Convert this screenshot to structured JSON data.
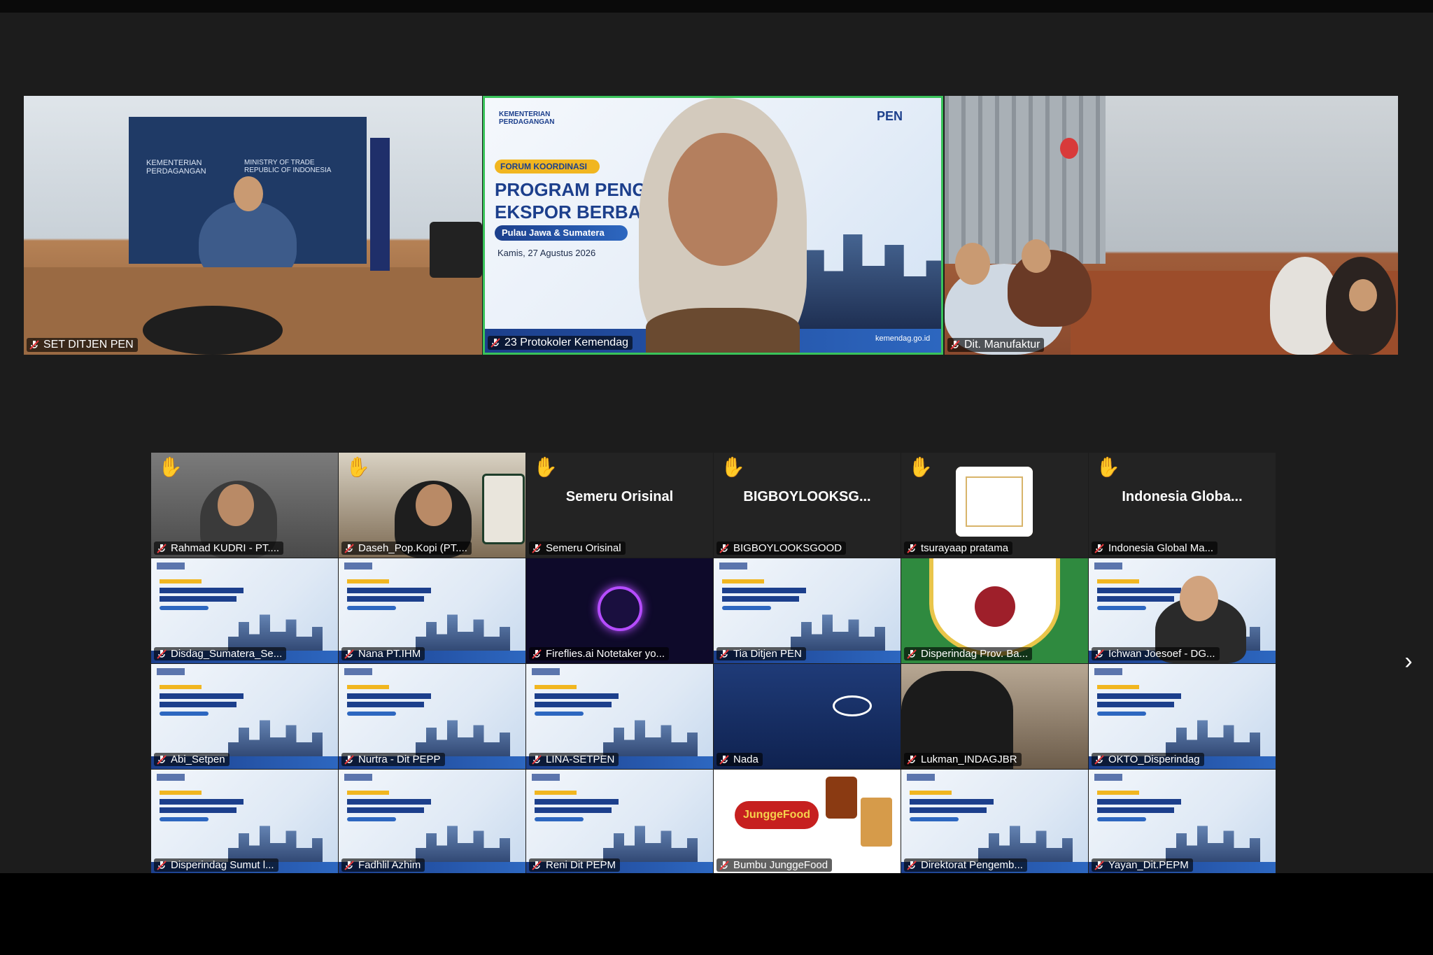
{
  "speakers": [
    {
      "name": "SET DITJEN PEN"
    },
    {
      "name": "23 Protokoler Kemendag"
    },
    {
      "name": "Dit. Manufaktur"
    }
  ],
  "slide": {
    "forum": "FORUM KOORDINASI",
    "title1": "PROGRAM PENGEMB",
    "title2": "EKSPOR BERBASIS K",
    "region": "Pulau Jawa & Sumatera",
    "date": "Kamis, 27 Agustus 2026",
    "ministry": "KEMENTERIAN PERDAGANGAN",
    "logo": "PEN",
    "website": "kemendag.go.id"
  },
  "office_wall": {
    "line1": "KEMENTERIAN PERDAGANGAN",
    "line2": "MINISTRY OF TRADE REPUBLIC OF INDONESIA"
  },
  "gallery_row1": [
    {
      "name": "Rahmad KUDRI - PT....",
      "hand": "✋",
      "type": "video"
    },
    {
      "name": "Daseh_Pop.Kopi (PT....",
      "hand": "✋",
      "type": "video"
    },
    {
      "name": "Semeru Orisinal",
      "display": "Semeru Orisinal",
      "hand": "✋",
      "type": "text"
    },
    {
      "name": "BIGBOYLOOKSGOOD",
      "display": "BIGBOYLOOKSG...",
      "hand": "✋",
      "type": "text"
    },
    {
      "name": "tsurayaap pratama",
      "hand": "✋",
      "type": "logo"
    },
    {
      "name": "Indonesia Global Ma...",
      "display": "Indonesia  Globa...",
      "hand": "✋",
      "type": "text"
    }
  ],
  "gallery_row2": [
    {
      "name": "Disdag_Sumatera_Se...",
      "type": "slide"
    },
    {
      "name": "Nana PT.IHM",
      "type": "slide"
    },
    {
      "name": "Fireflies.ai Notetaker yo...",
      "type": "fireflies"
    },
    {
      "name": "Tia Ditjen PEN",
      "type": "slide"
    },
    {
      "name": "Disperindag Prov. Ba...",
      "type": "emblem"
    },
    {
      "name": "Ichwan Joesoef - DG...",
      "type": "slide-person"
    }
  ],
  "gallery_row3": [
    {
      "name": "Abi_Setpen",
      "type": "slide"
    },
    {
      "name": "Nurtra - Dit PEPP",
      "type": "slide"
    },
    {
      "name": "LINA-SETPEN",
      "type": "slide"
    },
    {
      "name": "Nada",
      "type": "nada"
    },
    {
      "name": "Lukman_INDAGJBR",
      "type": "room"
    },
    {
      "name": "OKTO_Disperindag",
      "type": "slide"
    }
  ],
  "gallery_row4": [
    {
      "name": "Disperindag Sumut l...",
      "type": "slide"
    },
    {
      "name": "Fadhlil Azhim",
      "type": "slide"
    },
    {
      "name": "Reni Dit PEPM",
      "type": "slide"
    },
    {
      "name": "Bumbu JunggeFood",
      "type": "food"
    },
    {
      "name": "Direktorat Pengemb...",
      "type": "slide"
    },
    {
      "name": "Yayan_Dit.PEPM",
      "type": "slide"
    }
  ],
  "food_brand": "JunggeFood",
  "next_page": "›",
  "colors": {
    "speaking_border": "#39c35a",
    "mute_icon": "#e5383b",
    "background": "#1c1c1c"
  }
}
